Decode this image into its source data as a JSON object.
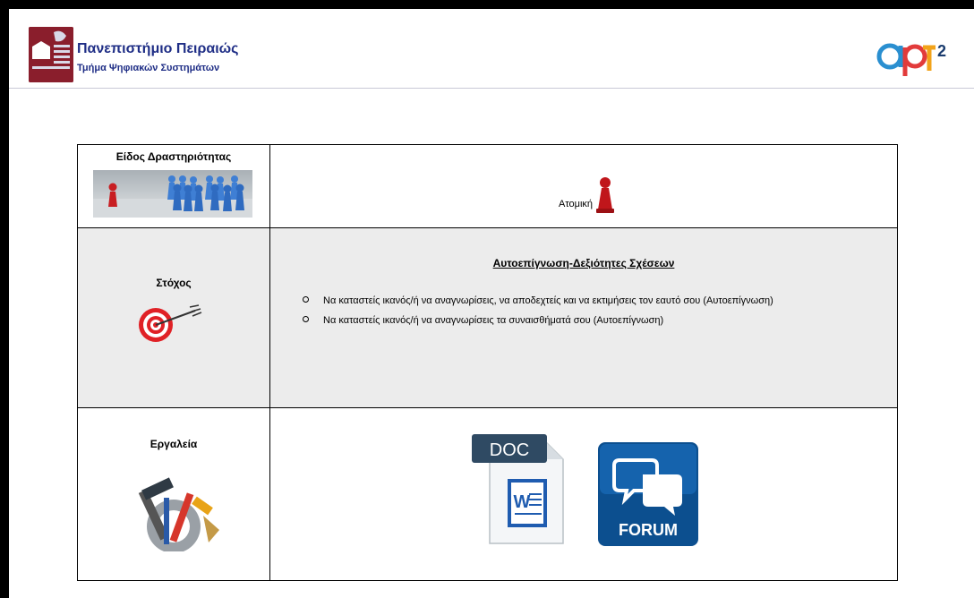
{
  "header": {
    "university_name": "Πανεπιστήμιο Πειραιώς",
    "department": "Τμήμα Ψηφιακών Συστημάτων",
    "logo_left_icon": "university-of-piraeus-logo",
    "logo_right_icon": "apt2-logo",
    "colors": {
      "university_text": "#1f2e86",
      "university_logo": "#8a1e2c"
    }
  },
  "table": {
    "row_type": {
      "label": "Είδος Δραστηριότητας",
      "value": "Ατομική",
      "image": "pawns-image",
      "value_icon": "red-pawn-icon"
    },
    "row_goal": {
      "label": "Στόχος",
      "icon": "target-icon",
      "title": "Αυτοεπίγνωση-Δεξιότητες Σχέσεων",
      "items": [
        "Να καταστείς ικανός/ή να αναγνωρίσεις, να αποδεχτείς και να εκτιμήσεις τον εαυτό σου (Αυτοεπίγνωση)",
        "Να καταστείς ικανός/ή να αναγνωρίσεις τα συναισθήματά σου (Αυτοεπίγνωση)"
      ],
      "background": "#ececec"
    },
    "row_tools": {
      "label": "Εργαλεία",
      "icon": "tools-icon",
      "doc_badge": "DOC",
      "doc_icon_letter": "W",
      "forum_label": "FORUM"
    }
  }
}
